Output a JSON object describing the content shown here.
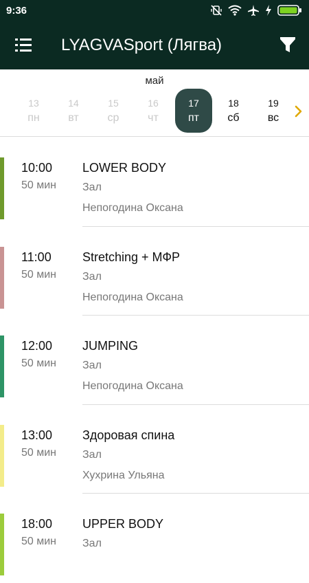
{
  "status": {
    "time": "9:36",
    "icons": [
      "no-vibrate-icon",
      "wifi-icon",
      "airplane-icon",
      "charging-icon",
      "battery-icon"
    ],
    "battery_color": "#7ed321"
  },
  "appbar": {
    "title": "LYAGVASport (Лягва)",
    "background": "#0b2a22"
  },
  "dates": {
    "month": "май",
    "days": [
      {
        "num": "13",
        "wd": "пн",
        "state": "past"
      },
      {
        "num": "14",
        "wd": "вт",
        "state": "past"
      },
      {
        "num": "15",
        "wd": "ср",
        "state": "past"
      },
      {
        "num": "16",
        "wd": "чт",
        "state": "past"
      },
      {
        "num": "17",
        "wd": "пт",
        "state": "selected"
      },
      {
        "num": "18",
        "wd": "сб",
        "state": "future"
      },
      {
        "num": "19",
        "wd": "вс",
        "state": "future"
      }
    ],
    "selected_color": "#2f4a47",
    "arrow_color": "#e0a800"
  },
  "classes": [
    {
      "time": "10:00",
      "duration": "50 мин",
      "title": "LOWER BODY",
      "room": "Зал",
      "trainer": "Непогодина Оксана",
      "color": "#6f9a2c"
    },
    {
      "time": "11:00",
      "duration": "50 мин",
      "title": "Stretching + МФР",
      "room": "Зал",
      "trainer": "Непогодина Оксана",
      "color": "#c99393"
    },
    {
      "time": "12:00",
      "duration": "50 мин",
      "title": "JUMPING",
      "room": "Зал",
      "trainer": "Непогодина Оксана",
      "color": "#2e9466"
    },
    {
      "time": "13:00",
      "duration": "50 мин",
      "title": "Здоровая спина",
      "room": "Зал",
      "trainer": "Хухрина Ульяна",
      "color": "#f3ec8a"
    },
    {
      "time": "18:00",
      "duration": "50 мин",
      "title": "UPPER BODY",
      "room": "Зал",
      "trainer": "",
      "color": "#9ccc3c"
    }
  ]
}
